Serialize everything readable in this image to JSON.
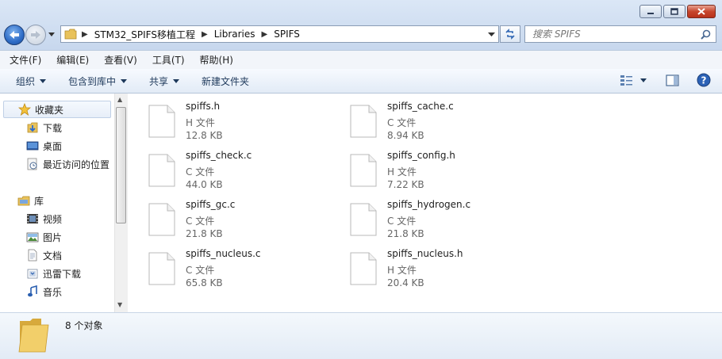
{
  "window": {
    "caption": {
      "minimize": "minimize",
      "maximize": "maximize",
      "close": "close"
    }
  },
  "address": {
    "crumbs": [
      "STM32_SPIFS移植工程",
      "Libraries",
      "SPIFS"
    ],
    "separator": "▶"
  },
  "search": {
    "placeholder": "搜索 SPIFS"
  },
  "menu": [
    "文件(F)",
    "编辑(E)",
    "查看(V)",
    "工具(T)",
    "帮助(H)"
  ],
  "toolbar": {
    "organize": "组织",
    "include_in_library": "包含到库中",
    "share": "共享",
    "new_folder": "新建文件夹"
  },
  "nav": {
    "favorites": "收藏夹",
    "downloads": "下载",
    "desktop": "桌面",
    "recent": "最近访问的位置",
    "libraries": "库",
    "videos": "视频",
    "pictures": "图片",
    "documents": "文档",
    "xunlei": "迅雷下载",
    "music": "音乐"
  },
  "files": [
    {
      "name": "spiffs.h",
      "type": "H 文件",
      "size": "12.8 KB"
    },
    {
      "name": "spiffs_cache.c",
      "type": "C 文件",
      "size": "8.94 KB"
    },
    {
      "name": "spiffs_check.c",
      "type": "C 文件",
      "size": "44.0 KB"
    },
    {
      "name": "spiffs_config.h",
      "type": "H 文件",
      "size": "7.22 KB"
    },
    {
      "name": "spiffs_gc.c",
      "type": "C 文件",
      "size": "21.8 KB"
    },
    {
      "name": "spiffs_hydrogen.c",
      "type": "C 文件",
      "size": "21.8 KB"
    },
    {
      "name": "spiffs_nucleus.c",
      "type": "C 文件",
      "size": "65.8 KB"
    },
    {
      "name": "spiffs_nucleus.h",
      "type": "H 文件",
      "size": "20.4 KB"
    }
  ],
  "status": {
    "count": "8 个对象"
  },
  "colors": {
    "accent": "#1e395b",
    "selection": "#e7eef8",
    "window_frame": "#c8d8ee"
  }
}
